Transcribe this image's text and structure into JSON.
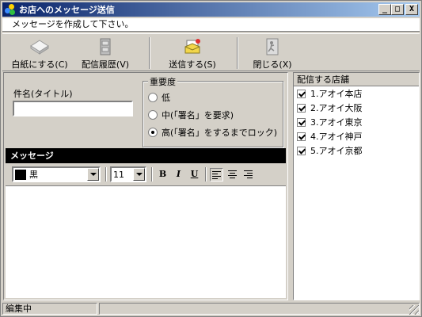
{
  "window": {
    "title": "お店へのメッセージ送信"
  },
  "titlebar_buttons": {
    "minimize": "_",
    "maximize": "□",
    "close": "X"
  },
  "instruction": "メッセージを作成して下さい。",
  "toolbar": {
    "new_label": "白紙にする(C)",
    "history_label": "配信履歴(V)",
    "send_label": "送信する(S)",
    "close_label": "閉じる(X)"
  },
  "subject": {
    "label": "件名(タイトル)",
    "value": ""
  },
  "priority": {
    "legend": "重要度",
    "options": [
      "低",
      "中(「署名」を要求)",
      "高(「署名」をするまでロック)"
    ],
    "selected_index": 2
  },
  "message": {
    "header": "メッセージ",
    "color_value": "黒",
    "color_swatch": "#000000",
    "size_value": "11",
    "bold": "B",
    "italic": "I",
    "underline": "U",
    "body": ""
  },
  "stores": {
    "header": "配信する店舗",
    "items": [
      {
        "label": "1.アオイ本店",
        "checked": true
      },
      {
        "label": "2.アオイ大阪",
        "checked": true
      },
      {
        "label": "3.アオイ東京",
        "checked": true
      },
      {
        "label": "4.アオイ神戸",
        "checked": true
      },
      {
        "label": "5.アオイ京都",
        "checked": true
      }
    ]
  },
  "status": {
    "text": "編集中"
  },
  "colors": {
    "title_start": "#0a246a",
    "title_end": "#a6caf0",
    "face": "#d4d0c8"
  },
  "icons": {
    "app": "app-balls-icon",
    "new": "blank-page-icon",
    "history": "file-cabinet-icon",
    "send": "send-mail-icon",
    "close": "exit-door-icon"
  }
}
